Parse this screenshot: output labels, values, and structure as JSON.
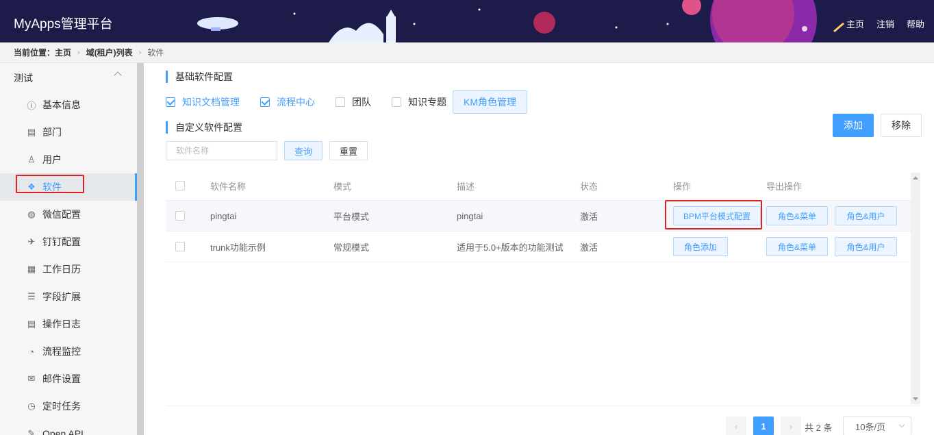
{
  "header": {
    "brand": "MyApps管理平台",
    "nav": [
      "主页",
      "注销",
      "帮助"
    ]
  },
  "breadcrumb": {
    "prefix": "当前位置：主页",
    "level2": "域(租户)列表",
    "current": "软件"
  },
  "sidebar": {
    "group": "测试",
    "items": [
      {
        "label": "基本信息",
        "icon": "info-circle-icon"
      },
      {
        "label": "部门",
        "icon": "building-icon"
      },
      {
        "label": "用户",
        "icon": "user-icon"
      },
      {
        "label": "软件",
        "icon": "cubes-icon",
        "active": true
      },
      {
        "label": "微信配置",
        "icon": "wechat-icon"
      },
      {
        "label": "钉钉配置",
        "icon": "plane-icon"
      },
      {
        "label": "工作日历",
        "icon": "calendar-icon"
      },
      {
        "label": "字段扩展",
        "icon": "sliders-icon"
      },
      {
        "label": "操作日志",
        "icon": "log-icon"
      },
      {
        "label": "流程监控",
        "icon": "dashboard-icon"
      },
      {
        "label": "邮件设置",
        "icon": "envelope-icon"
      },
      {
        "label": "定时任务",
        "icon": "clock-icon"
      },
      {
        "label": "Open API",
        "icon": "wrench-icon"
      }
    ]
  },
  "basic_config": {
    "title": "基础软件配置",
    "options": [
      {
        "label": "知识文档管理",
        "checked": true
      },
      {
        "label": "流程中心",
        "checked": true
      },
      {
        "label": "团队",
        "checked": false
      },
      {
        "label": "知识专题",
        "checked": false
      }
    ],
    "km_button": "KM角色管理"
  },
  "custom_config": {
    "title": "自定义软件配置",
    "add_label": "添加",
    "remove_label": "移除",
    "search_placeholder": "软件名称",
    "query_label": "查询",
    "reset_label": "重置"
  },
  "table": {
    "columns": [
      "软件名称",
      "模式",
      "描述",
      "状态",
      "操作",
      "导出操作"
    ],
    "rows": [
      {
        "name": "pingtai",
        "mode": "平台模式",
        "desc": "pingtai",
        "status": "激活",
        "action": "BPM平台模式配置",
        "export1": "角色&菜单",
        "export2": "角色&用户"
      },
      {
        "name": "trunk功能示例",
        "mode": "常规模式",
        "desc": "适用于5.0+版本的功能测试",
        "status": "激活",
        "action": "角色添加",
        "export1": "角色&菜单",
        "export2": "角色&用户"
      }
    ]
  },
  "pagination": {
    "current": "1",
    "total": "共 2 条",
    "page_size": "10条/页",
    "prev": "‹",
    "next": "›"
  },
  "colors": {
    "accent": "#409eff",
    "header_bg": "#1d1b4a",
    "highlight": "#e02020"
  }
}
